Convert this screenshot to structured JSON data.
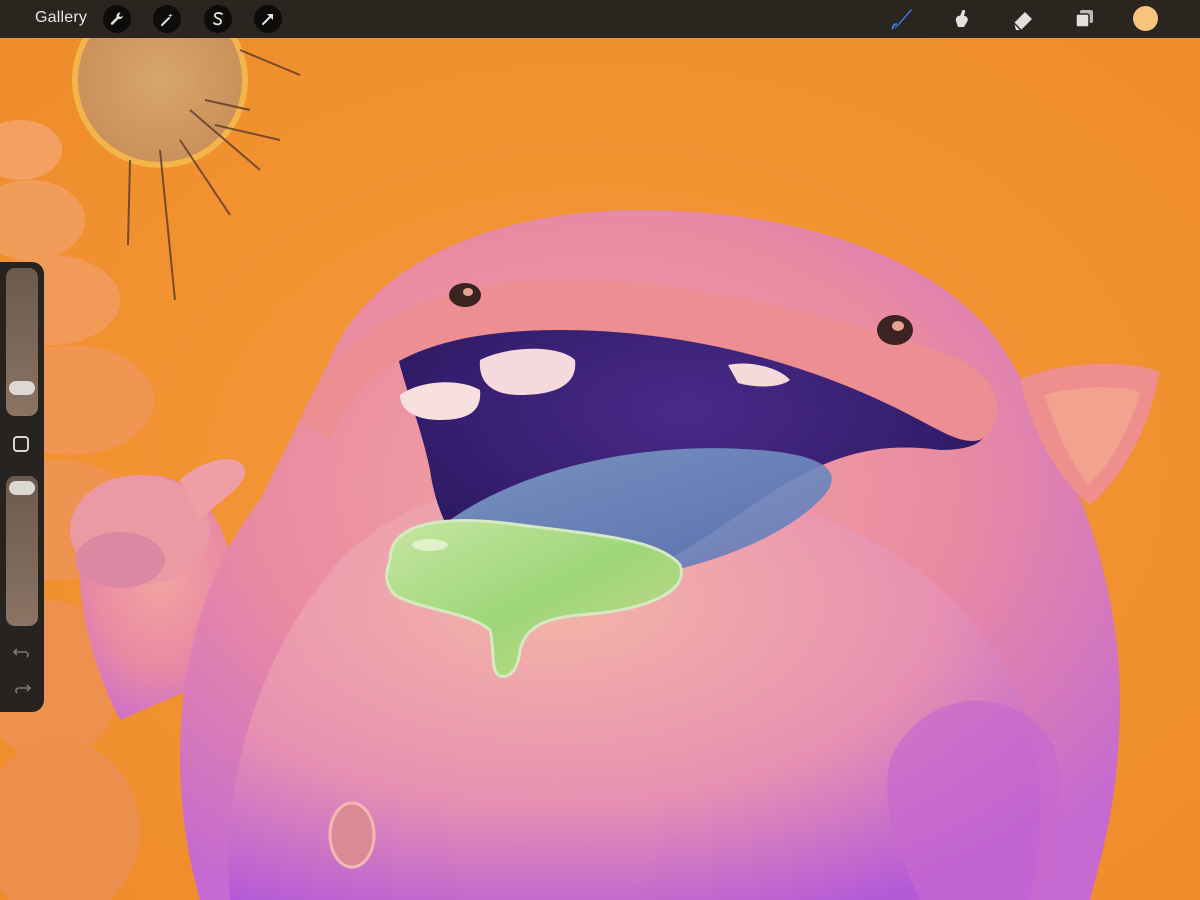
{
  "app": {
    "gallery_label": "Gallery"
  },
  "toolbar_left": [
    {
      "name": "actions",
      "icon": "wrench-icon"
    },
    {
      "name": "adjustments",
      "icon": "magic-wand-icon"
    },
    {
      "name": "selection",
      "icon": "selection-s-icon"
    },
    {
      "name": "transform",
      "icon": "arrow-cursor-icon"
    }
  ],
  "toolbar_right": [
    {
      "name": "brush",
      "icon": "brush-icon",
      "active": true
    },
    {
      "name": "smudge",
      "icon": "smudge-icon"
    },
    {
      "name": "eraser",
      "icon": "eraser-icon"
    },
    {
      "name": "layers",
      "icon": "layers-icon"
    }
  ],
  "current_color": "#f7c47c",
  "accent_color": "#3a7be8",
  "sidebar": {
    "brush_size_level": 0.2,
    "opacity_level": 1.0
  }
}
